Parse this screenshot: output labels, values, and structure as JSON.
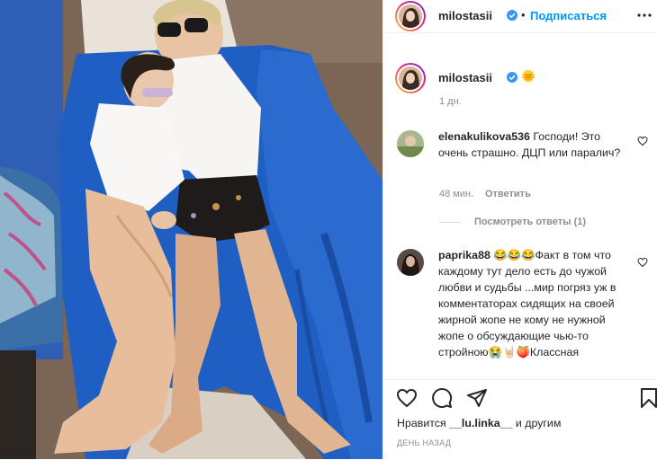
{
  "header": {
    "username": "milostasii",
    "separator": "•",
    "follow_label": "Подписаться"
  },
  "caption": {
    "username": "milostasii",
    "emoji": "🌞",
    "time": "1 дн."
  },
  "comments": [
    {
      "username": "elenakulikova536",
      "text": "Господи! Это очень страшно. ДЦП или паралич?",
      "time": "48 мин.",
      "reply_label": "Ответить",
      "view_replies": "Посмотреть ответы (1)"
    },
    {
      "username": "paprika88",
      "text": "😂😂😂Факт в том что каждому тут дело есть до чужой любви и судьбы ...мир погряз уж в комментаторах сидящих на своей жирной жопе не кому не нужной жопе о обсуждающие чью-то стройною😭🤘🏻🍑Классная"
    }
  ],
  "likes": {
    "prefix": "Нравится",
    "user": "__lu.linka__",
    "suffix": "и другим"
  },
  "date": "ДЕНЬ НАЗАД",
  "icons": [
    "more-options-icon",
    "verified-badge-icon",
    "like-heart-icon",
    "comment-bubble-icon",
    "share-plane-icon",
    "save-bookmark-icon"
  ],
  "colors": {
    "accent": "#0095f6",
    "verified": "#3897f0",
    "text": "#262626",
    "muted": "#8e8e8e"
  }
}
